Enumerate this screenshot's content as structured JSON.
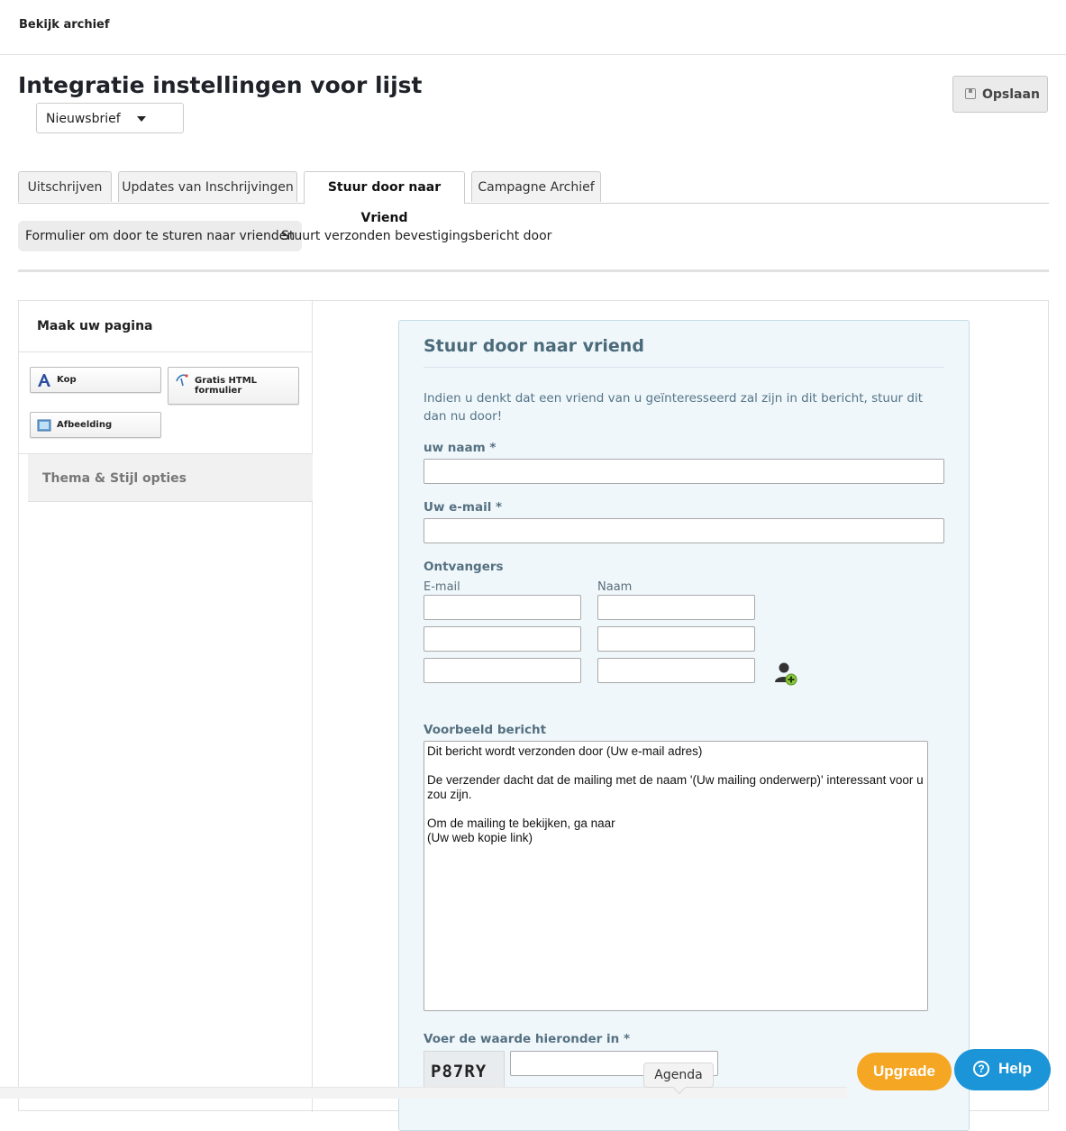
{
  "topbar": {
    "archive_link": "Bekijk archief"
  },
  "header": {
    "title": "Integratie instellingen voor lijst",
    "list_select_value": "Nieuwsbrief",
    "save_label": "Opslaan"
  },
  "tabs": [
    {
      "label": "Uitschrijven",
      "active": false
    },
    {
      "label": "Updates van Inschrijvingen",
      "active": false
    },
    {
      "label": "Stuur door naar Vriend",
      "active": true
    },
    {
      "label": "Campagne Archief",
      "active": false
    }
  ],
  "subtabs": [
    {
      "label": "Formulier om door te sturen naar vrienden",
      "active": true
    },
    {
      "label": "Stuurt verzonden bevestigingsbericht door",
      "active": false
    }
  ],
  "sidebar": {
    "title": "Maak uw pagina",
    "blocks": [
      {
        "label": "Kop",
        "icon": "heading-icon"
      },
      {
        "label": "Gratis HTML formulier",
        "icon": "html-form-icon"
      },
      {
        "label": "Afbeelding",
        "icon": "image-icon"
      }
    ],
    "theme_label": "Thema & Stijl opties"
  },
  "form": {
    "title": "Stuur door naar vriend",
    "intro": "Indien u denkt dat een vriend van u geïnteresseerd zal zijn in dit bericht, stuur dit dan nu door!",
    "name_label": "uw naam *",
    "email_label": "Uw e-mail *",
    "recipients_label": "Ontvangers",
    "col_email": "E-mail",
    "col_name": "Naam",
    "message_label": "Voorbeeld bericht",
    "message_text": "Dit bericht wordt verzonden door (Uw e-mail adres)\n\nDe verzender dacht dat de mailing met de naam '(Uw mailing onderwerp)' interessant voor u zou zijn.\n\nOm de mailing te bekijken, ga naar\n(Uw web kopie link)",
    "captcha_label": "Voer de waarde hieronder in *",
    "captcha_code": "P87RY"
  },
  "tooltip": {
    "label": "Agenda"
  },
  "widgets": {
    "upgrade_label": "Upgrade",
    "help_label": "Help",
    "accent_orange": "#f5a623",
    "accent_blue": "#1b95d8"
  }
}
